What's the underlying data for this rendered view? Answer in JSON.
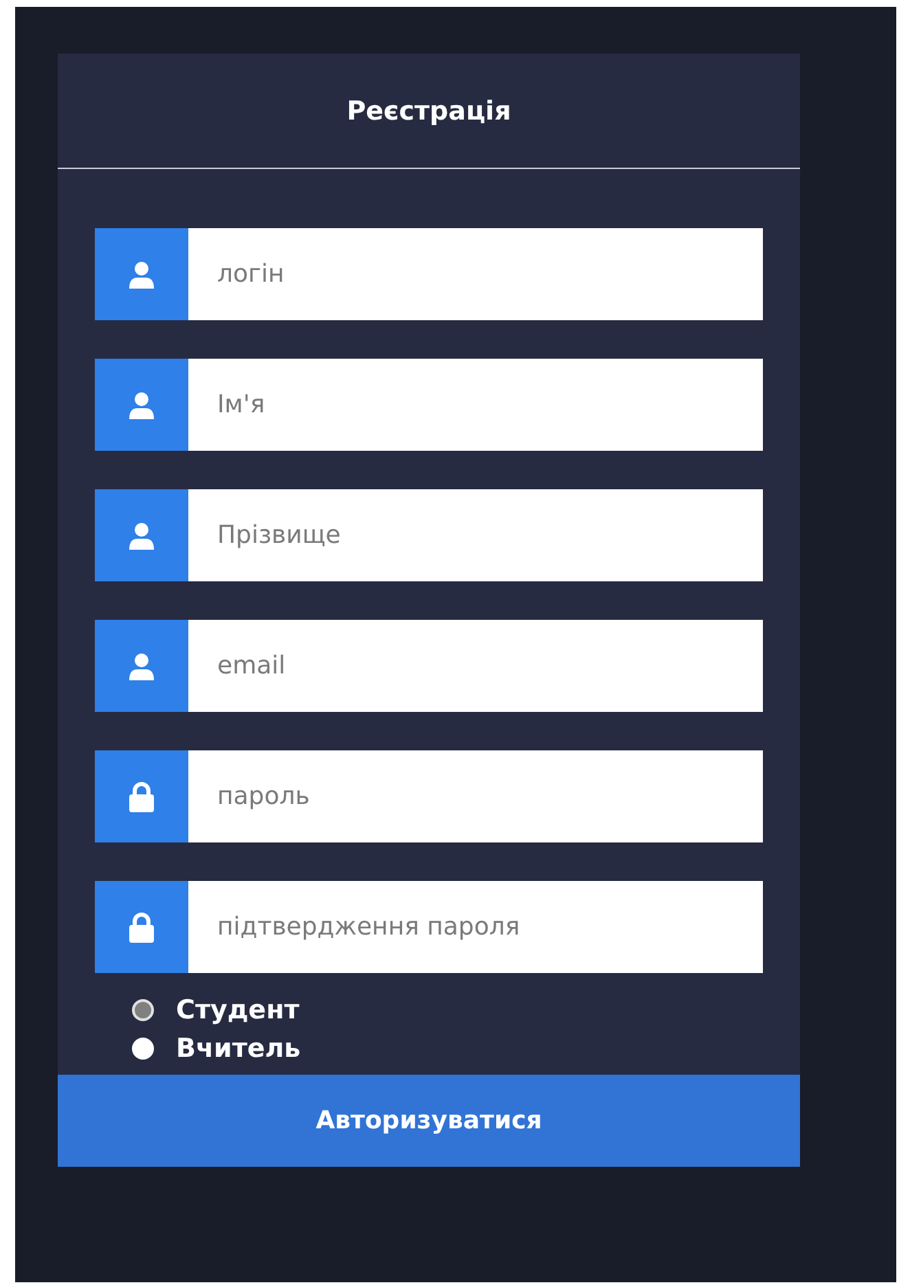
{
  "title": "Реєстрація",
  "fields": [
    {
      "kind": "user",
      "placeholder": "логін"
    },
    {
      "kind": "user",
      "placeholder": "Ім'я"
    },
    {
      "kind": "user",
      "placeholder": "Прізвище"
    },
    {
      "kind": "user",
      "placeholder": "email"
    },
    {
      "kind": "lock",
      "placeholder": "пароль"
    },
    {
      "kind": "lock",
      "placeholder": "підтвердження пароля"
    }
  ],
  "roles": [
    {
      "label": "Студент",
      "selected": true
    },
    {
      "label": "Вчитель",
      "selected": false
    }
  ],
  "submit": "Авторизуватися"
}
